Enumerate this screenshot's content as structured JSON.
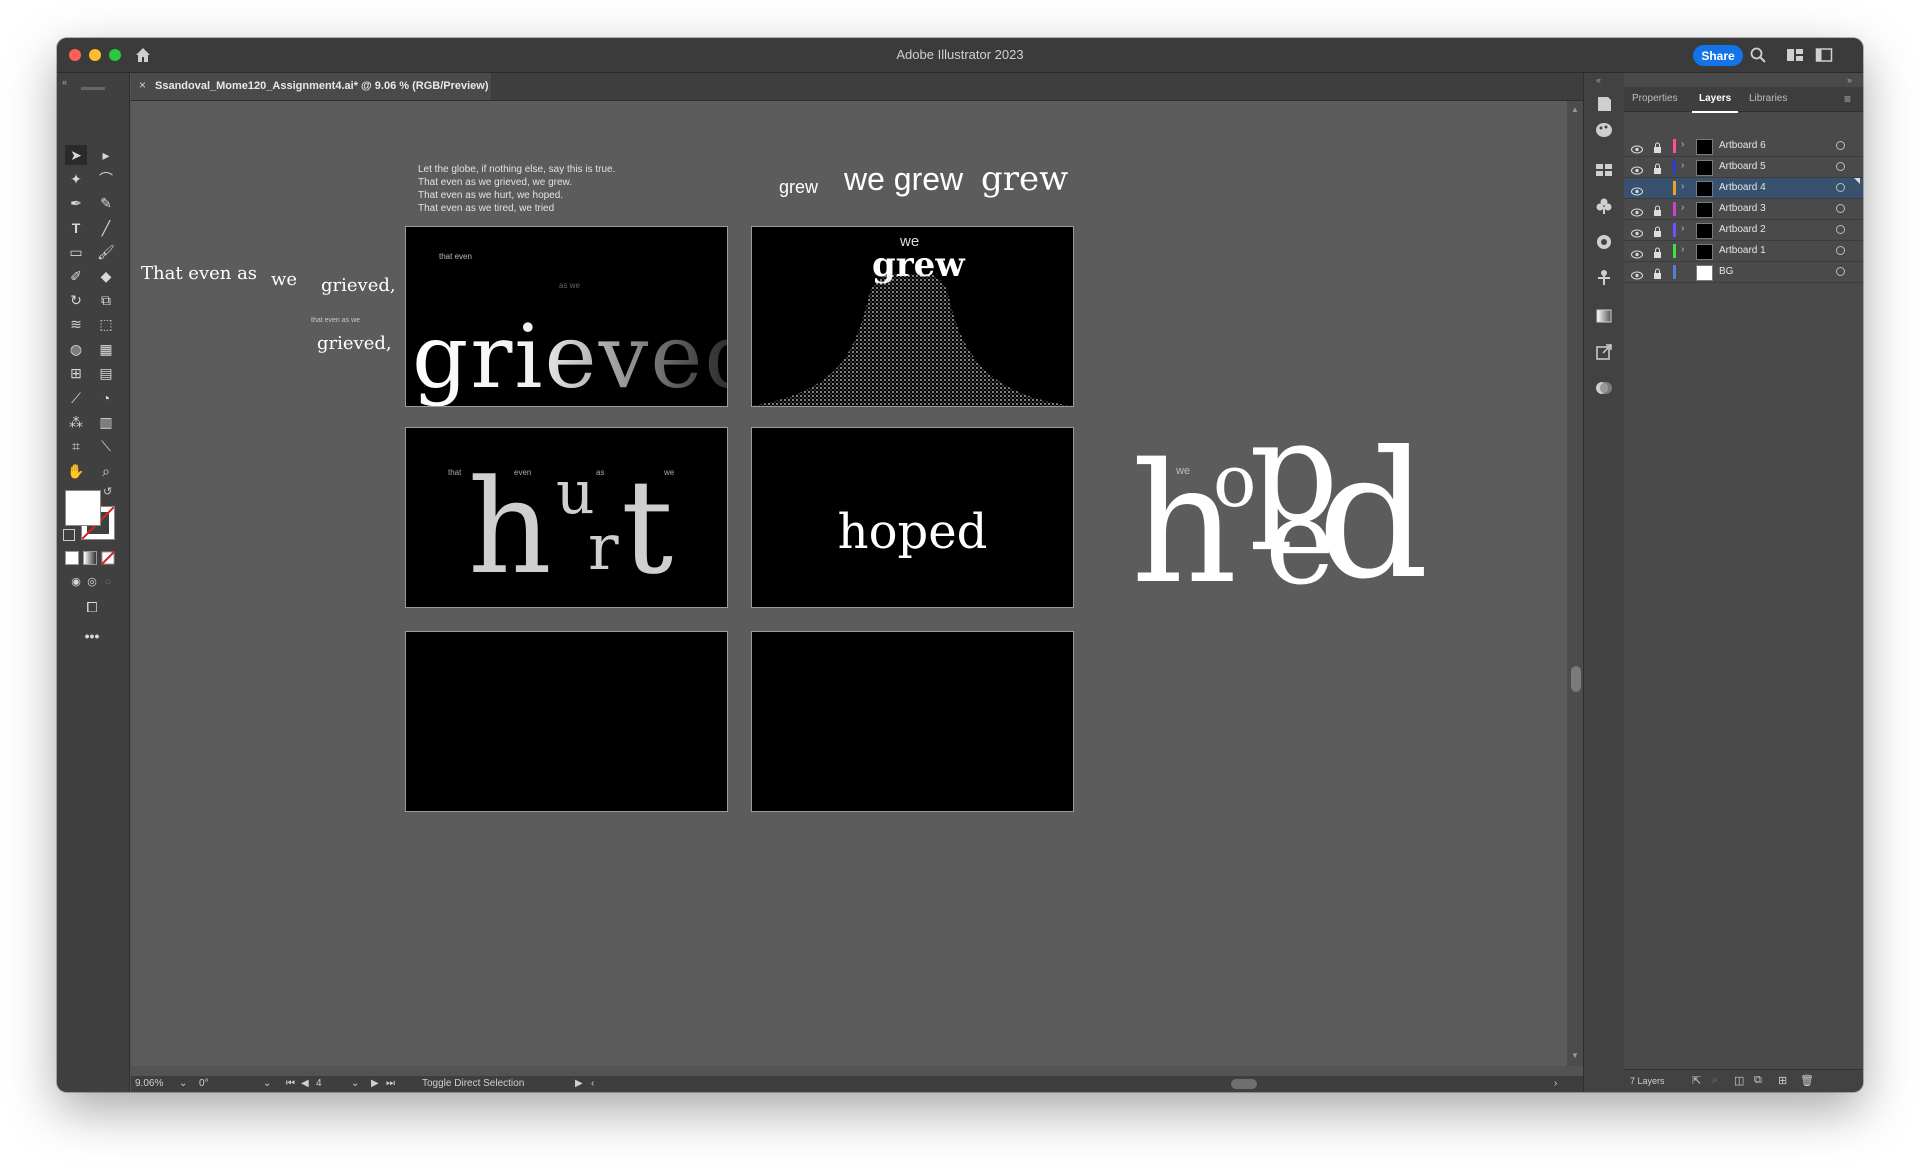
{
  "app": {
    "title": "Adobe Illustrator 2023",
    "share_label": "Share"
  },
  "document": {
    "tab_title": "Ssandoval_Mome120_Assignment4.ai* @ 9.06 % (RGB/Preview)",
    "close_glyph": "×"
  },
  "canvas": {
    "poem_lines": [
      "Let the globe, if nothing else, say this is true.",
      "That even as we grieved, we grew.",
      "That even as we hurt, we hoped.",
      "That even as we tired, we tried"
    ],
    "loose_text": {
      "that_even_as": "That even as",
      "we": "we",
      "grieved_1": "grieved,",
      "small_that_even_as_we": "that even as we",
      "grieved_2": "grieved,",
      "grew_small": "grew",
      "we_grew": "we grew",
      "grew_large": "grew"
    },
    "artboard1": {
      "word": "grieved",
      "that_even": "that  even",
      "as_we": "as we"
    },
    "artboard2": {
      "we": "we",
      "grew": "grew"
    },
    "artboard3": {
      "that": "that",
      "even": "even",
      "as": "as",
      "we": "we",
      "h": "h",
      "u": "u",
      "r": "r",
      "t": "t"
    },
    "artboard4": {
      "word": "hoped"
    },
    "hoped_sculpture": {
      "we": "we",
      "h": "h",
      "o": "o",
      "p": "p",
      "e": "e",
      "d": "d"
    }
  },
  "status_bar": {
    "zoom": "9.06%",
    "rotation": "0°",
    "artboard_number": "4",
    "hint": "Toggle Direct Selection"
  },
  "panel": {
    "tabs": [
      "Properties",
      "Layers",
      "Libraries"
    ],
    "active_tab": "Layers",
    "layers": [
      {
        "name": "Artboard 6",
        "color": "#ff4fa0",
        "locked": true
      },
      {
        "name": "Artboard 5",
        "color": "#2a3bd6",
        "locked": true
      },
      {
        "name": "Artboard 4",
        "color": "#f0a020",
        "locked": false,
        "selected": true
      },
      {
        "name": "Artboard 3",
        "color": "#d040d0",
        "locked": true
      },
      {
        "name": "Artboard 2",
        "color": "#7050ff",
        "locked": true
      },
      {
        "name": "Artboard 1",
        "color": "#40e040",
        "locked": true
      },
      {
        "name": "BG",
        "color": "#4f7fd8",
        "locked": true
      }
    ],
    "layer_count": "7 Layers"
  }
}
